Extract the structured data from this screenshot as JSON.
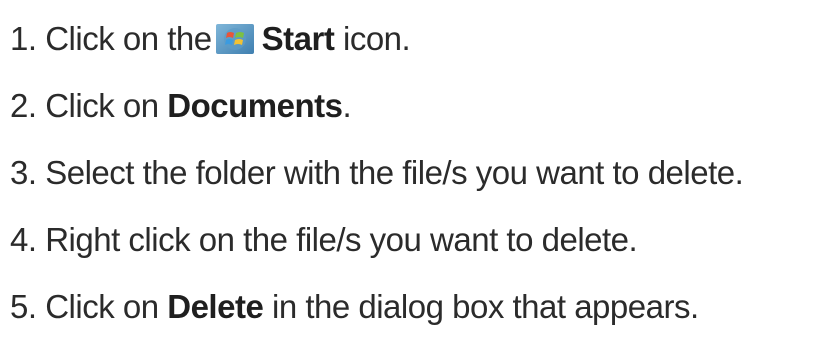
{
  "steps": [
    {
      "number": "1.",
      "before": "Click on the",
      "icon": "windows-start-orb-icon",
      "bold": "Start",
      "after": " icon."
    },
    {
      "number": "2.",
      "before": "Click on ",
      "bold": "Documents",
      "after": "."
    },
    {
      "number": "3.",
      "text": "Select the folder with the file/s you want to delete."
    },
    {
      "number": "4.",
      "text": "Right click on the file/s you want to delete."
    },
    {
      "number": "5.",
      "before": "Click on ",
      "bold": "Delete",
      "after": " in the dialog box that appears."
    }
  ]
}
